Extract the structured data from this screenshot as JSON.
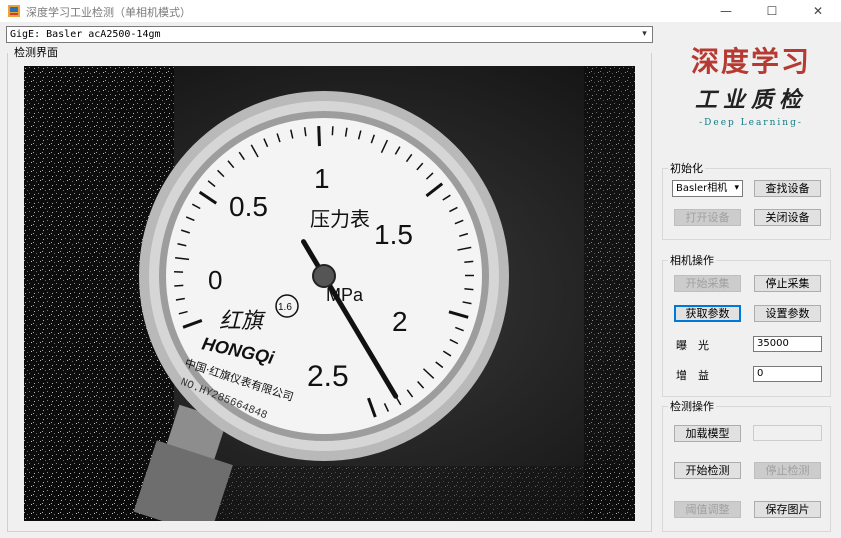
{
  "window": {
    "title": "深度学习工业检测（单相机模式）",
    "minimize_glyph": "—",
    "maximize_glyph": "☐",
    "close_glyph": "✕"
  },
  "camera_select": {
    "value": "GigE: Basler acA2500-14gm",
    "arrow": "▾"
  },
  "detect_panel": {
    "label": "检测界面"
  },
  "gauge": {
    "scale_labels": [
      "0",
      "0.5",
      "1",
      "1.5",
      "2",
      "2.5"
    ],
    "title": "压力表",
    "unit": "MPa",
    "class_mark": "1.6",
    "brand_script": "红旗",
    "brand_latin": "HONGQi",
    "maker": "中国·红旗仪表有限公司",
    "serial": "NO.HY285664848",
    "reading_mpa": 2.4
  },
  "logo": {
    "title": "深度学习",
    "subtitle": "工业质检",
    "english": "-Deep Learning-"
  },
  "init_group": {
    "label": "初始化",
    "camera_type": "Basler相机",
    "camera_type_arrow": "▾",
    "find_device": "查找设备",
    "open_device": "打开设备",
    "close_device": "关闭设备"
  },
  "camera_group": {
    "label": "相机操作",
    "start_capture": "开始采集",
    "stop_capture": "停止采集",
    "get_params": "获取参数",
    "set_params": "设置参数",
    "exposure_label": "曝　光",
    "exposure_value": "35000",
    "gain_label": "增　益",
    "gain_value": "0"
  },
  "detect_group": {
    "label": "检测操作",
    "load_model": "加载模型",
    "model_path": "",
    "start_detect": "开始检测",
    "stop_detect": "停止检测",
    "threshold_adjust": "阈值调整",
    "save_image": "保存图片"
  }
}
